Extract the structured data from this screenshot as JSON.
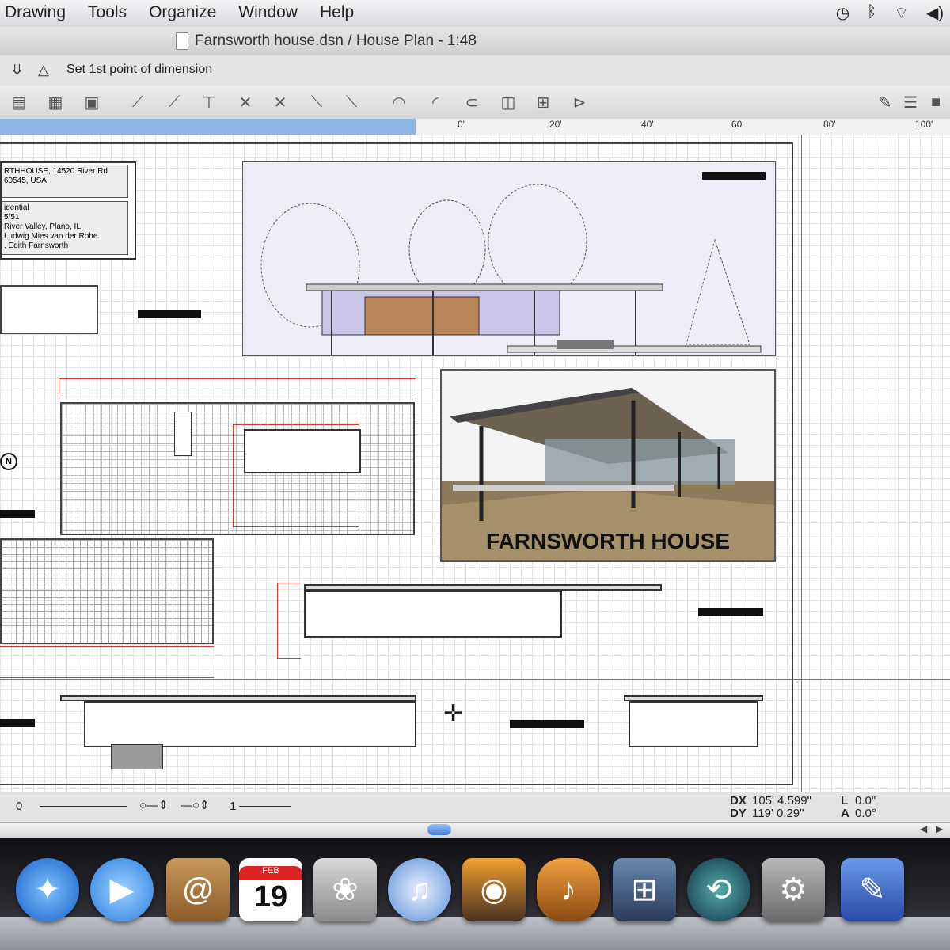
{
  "menubar": {
    "items": [
      "Drawing",
      "Tools",
      "Organize",
      "Window",
      "Help"
    ],
    "status_icons": [
      "time-machine-icon",
      "bluetooth-icon",
      "wifi-icon",
      "volume-icon"
    ]
  },
  "window": {
    "title": "Farnsworth house.dsn / House Plan - 1:48"
  },
  "prompt": {
    "message": "Set 1st point of dimension"
  },
  "ruler": {
    "ticks": [
      "0'",
      "20'",
      "40'",
      "60'",
      "80'",
      "100'"
    ]
  },
  "drawing": {
    "info_lines_top": [
      "RTHHOUSE, 14520 River Rd",
      "60545, USA"
    ],
    "info_lines_bottom": [
      "idential",
      "5/51",
      "River Valley, Plano, IL",
      "Ludwig Mies van der Rohe",
      ". Edith Farnsworth"
    ],
    "photo_caption": "FARNSWORTH HOUSE",
    "north_label": "N"
  },
  "statusbar": {
    "line_weight": "0",
    "scale_value": "1",
    "dx_label": "DX",
    "dx_value": "105' 4.599\"",
    "dy_label": "DY",
    "dy_value": "119' 0.29\"",
    "l_label": "L",
    "l_value": "0.0\"",
    "a_label": "A",
    "a_value": "0.0°"
  },
  "dock": {
    "apps": [
      "safari",
      "ichat",
      "address-book",
      "ical",
      "iphoto",
      "itunes",
      "image-capture",
      "garageband",
      "spaces",
      "time-machine",
      "system-preferences",
      "preview"
    ],
    "calendar": {
      "month": "FEB",
      "day": "19"
    }
  },
  "colors": {
    "ruler_selection": "#8fb4e6",
    "accent_red": "#d23a3a",
    "dock_bg": "#2a2a30"
  }
}
